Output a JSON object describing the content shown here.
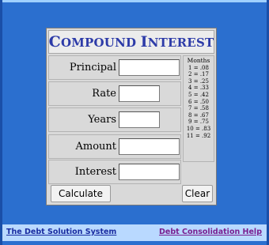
{
  "calculator": {
    "title_first_letter": "C",
    "title_rest_1": "OMPOUND",
    "title_second_letter": "I",
    "title_rest_2": "NTEREST",
    "fields": {
      "principal": {
        "label": "Principal",
        "value": ""
      },
      "rate": {
        "label": "Rate",
        "value": ""
      },
      "years": {
        "label": "Years",
        "value": ""
      },
      "amount": {
        "label": "Amount",
        "value": ""
      },
      "interest": {
        "label": "Interest",
        "value": ""
      }
    },
    "months_table": {
      "heading": "Months",
      "rows": [
        "1 = .08",
        "2 = .17",
        "3 = .25",
        "4 = .33",
        "5 = .42",
        "6 = .50",
        "7 = .58",
        "8 = .67",
        "9 = .75",
        "10 = .83",
        "11 = .92"
      ]
    },
    "buttons": {
      "calculate": "Calculate",
      "clear": "Clear"
    }
  },
  "footer": {
    "left_link": "The Debt Solution System",
    "right_link": "Debt Consolidation Help"
  },
  "colors": {
    "background": "#2b6fcf",
    "title": "#2d3ba8",
    "footer_bg": "#b9d9ff",
    "left_link": "#1a2ca0",
    "right_link": "#7a1f8f"
  }
}
